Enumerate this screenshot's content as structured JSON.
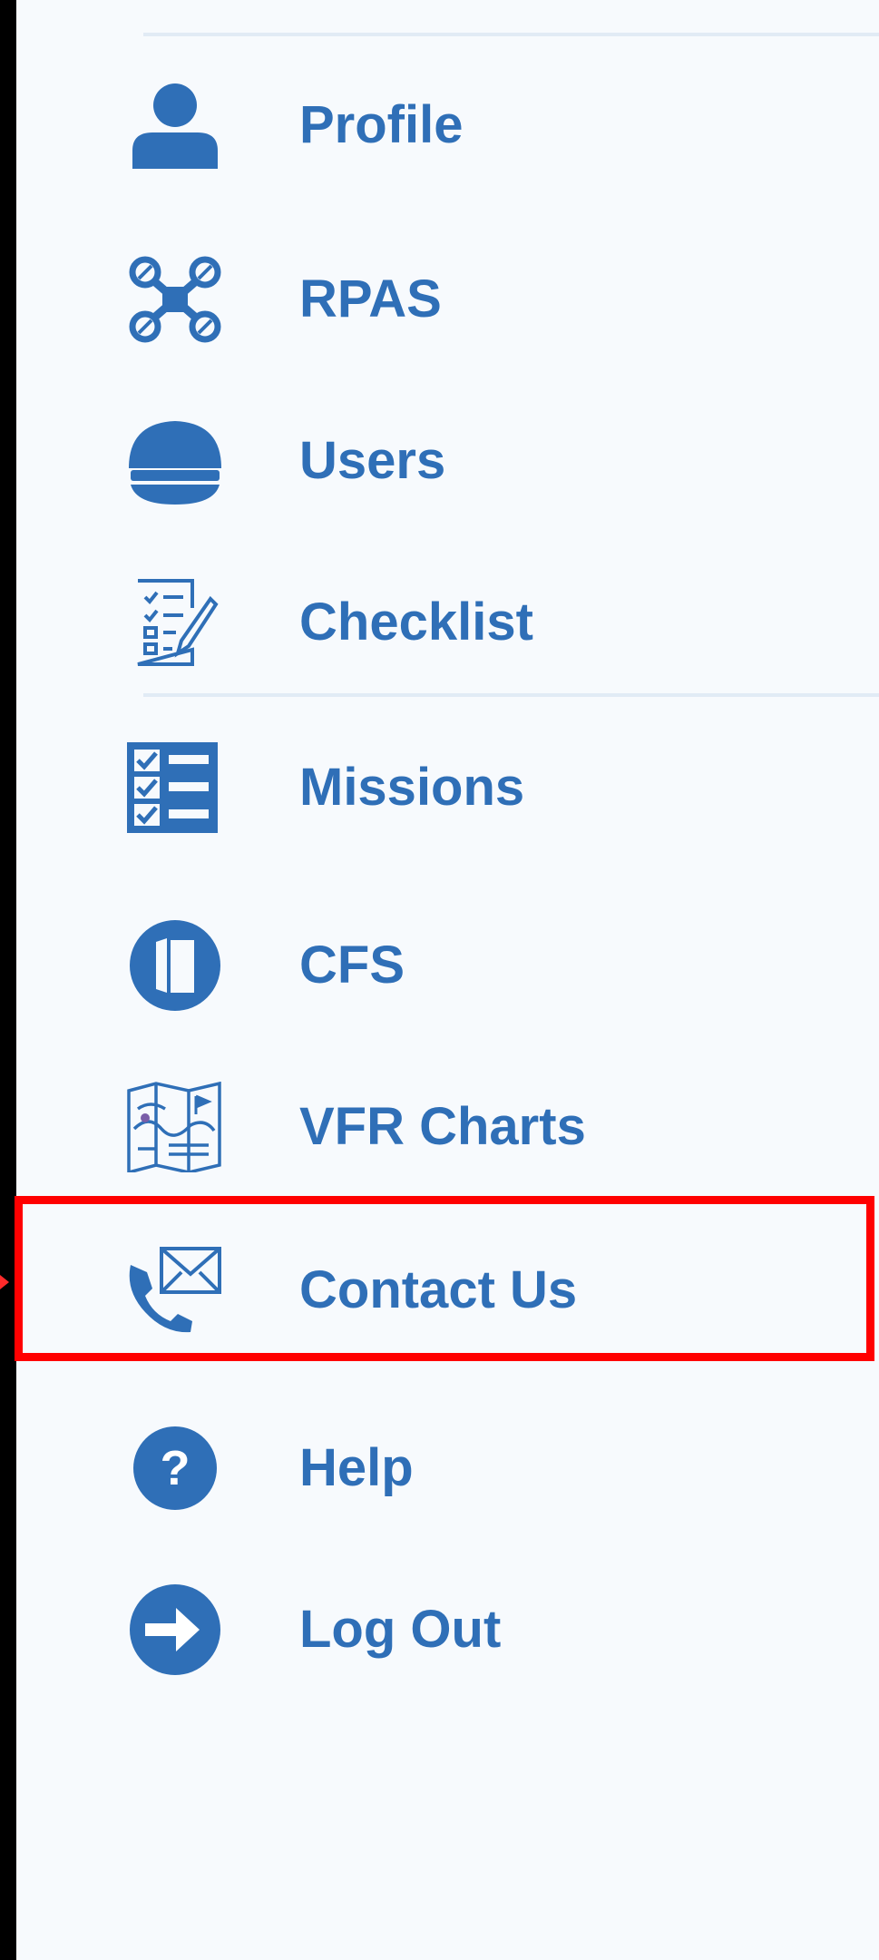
{
  "menu": {
    "items": [
      {
        "label": "Profile",
        "icon": "person-icon"
      },
      {
        "label": "RPAS",
        "icon": "drone-icon"
      },
      {
        "label": "Users",
        "icon": "pilot-cap-icon"
      },
      {
        "label": "Checklist",
        "icon": "checklist-icon"
      },
      {
        "label": "Missions",
        "icon": "missions-list-icon"
      },
      {
        "label": "CFS",
        "icon": "book-icon"
      },
      {
        "label": "VFR Charts",
        "icon": "map-icon"
      },
      {
        "label": "Contact Us",
        "icon": "phone-envelope-icon"
      },
      {
        "label": "Help",
        "icon": "question-circle-icon"
      },
      {
        "label": "Log Out",
        "icon": "logout-arrow-icon"
      }
    ]
  },
  "highlight": {
    "target": "Contact Us",
    "color": "#ff0000"
  },
  "colors": {
    "accent": "#2f6fb7",
    "panel_background": "#f7fafd",
    "divider": "#e1ebf5"
  }
}
